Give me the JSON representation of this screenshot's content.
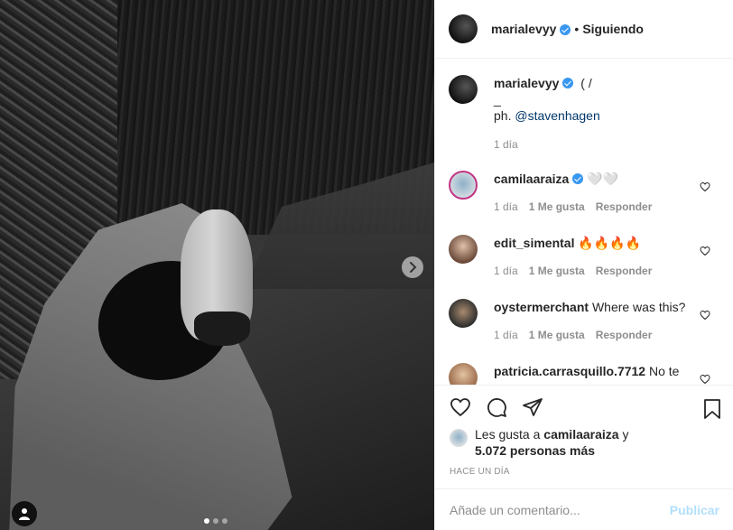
{
  "post": {
    "author": "marialevyy",
    "following_label": "Siguiendo",
    "separator": "•"
  },
  "caption": {
    "author": "marialevyy",
    "line1": "( /",
    "line2": "_",
    "line3_prefix": "ph. ",
    "mention": "@stavenhagen",
    "time": "1 día"
  },
  "comments": [
    {
      "user": "camilaaraiza",
      "verified": true,
      "text": "🤍🤍",
      "time": "1 día",
      "likes": "1 Me gusta",
      "reply": "Responder"
    },
    {
      "user": "edit_simental",
      "verified": false,
      "text": "🔥🔥🔥🔥",
      "time": "1 día",
      "likes": "1 Me gusta",
      "reply": "Responder"
    },
    {
      "user": "oystermerchant",
      "verified": false,
      "text": "Where was this?",
      "time": "1 día",
      "likes": "1 Me gusta",
      "reply": "Responder"
    },
    {
      "user": "patricia.carrasquillo.7712",
      "verified": false,
      "text": "No te",
      "time": "",
      "likes": "",
      "reply": ""
    }
  ],
  "likes": {
    "prefix": "Les gusta a ",
    "user": "camilaaraiza",
    "suffix": " y",
    "others": "5.072 personas más"
  },
  "time_ago": "HACE UN DÍA",
  "add_comment": {
    "placeholder": "Añade un comentario...",
    "publish": "Publicar"
  },
  "carousel": {
    "current": 1,
    "total": 3
  },
  "icons": [
    "heart-icon",
    "comment-icon",
    "share-icon",
    "bookmark-icon",
    "chevron-right-icon",
    "user-tag-icon"
  ],
  "colors": {
    "verified": "#3897f0",
    "publish_disabled": "#b2dffc",
    "muted": "#8e8e8e",
    "mention": "#00376b"
  }
}
